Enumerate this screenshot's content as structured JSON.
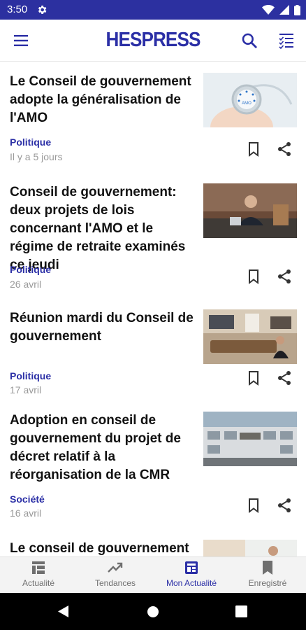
{
  "status_bar": {
    "time": "3:50"
  },
  "app_bar": {
    "logo": "HESPRESS"
  },
  "articles": [
    {
      "title": "Le Conseil de gouvernement adopte la généralisation de l'AMO",
      "category": "Politique",
      "date": "Il y a 5 jours",
      "thumb_text": "AMO"
    },
    {
      "title": "Conseil de gouvernement: deux projets de lois concernant l'AMO et le régime de retraite examinés ce jeudi",
      "category": "Politique",
      "date": "26 avril"
    },
    {
      "title": "Réunion mardi du Conseil de gouvernement",
      "category": "Politique",
      "date": "17 avril"
    },
    {
      "title": "Adoption en conseil de gouvernement du projet de décret relatif à la réorganisation de la CMR",
      "category": "Société",
      "date": "16 avril"
    },
    {
      "title": "Le conseil de gouvernement"
    }
  ],
  "bottom_nav": [
    {
      "label": "Actualité",
      "icon": "news-grid-icon"
    },
    {
      "label": "Tendances",
      "icon": "trending-icon"
    },
    {
      "label": "Mon Actualité",
      "icon": "my-news-icon",
      "active": true
    },
    {
      "label": "Enregistré",
      "icon": "bookmark-icon"
    }
  ],
  "colors": {
    "brand": "#2b2fa6",
    "status_bar": "#2c30a0",
    "date_gray": "#9a9a9a"
  }
}
